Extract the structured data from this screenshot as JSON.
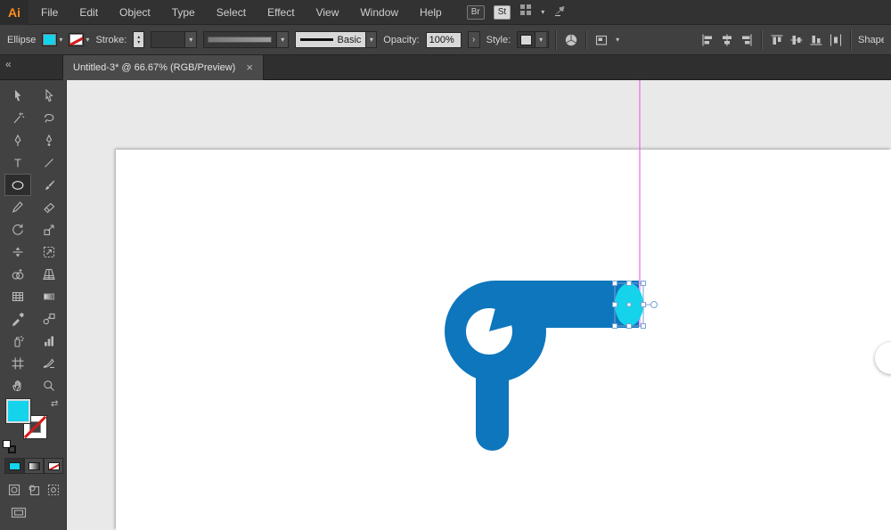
{
  "app": {
    "logo": "Ai"
  },
  "menu": {
    "items": [
      "File",
      "Edit",
      "Object",
      "Type",
      "Select",
      "Effect",
      "View",
      "Window",
      "Help"
    ]
  },
  "menu_right": {
    "bridge": "Br",
    "stock": "St"
  },
  "control": {
    "tool_name": "Ellipse",
    "stroke_label": "Stroke:",
    "brush_name": "Basic",
    "opacity_label": "Opacity:",
    "opacity_value": "100%",
    "style_label": "Style:",
    "shape_label": "Shape"
  },
  "tab": {
    "title": "Untitled-3* @ 66.67% (RGB/Preview)"
  },
  "toolbar": {
    "active_tool": "ellipse",
    "tools": [
      "selection",
      "direct-selection",
      "magic-wand",
      "lasso",
      "pen",
      "curvature",
      "type",
      "line-segment",
      "ellipse",
      "paintbrush",
      "pencil",
      "eraser",
      "rotate",
      "scale",
      "width",
      "free-transform",
      "shape-builder",
      "perspective-grid",
      "mesh",
      "gradient",
      "eyedropper",
      "blend",
      "symbol-sprayer",
      "column-graph",
      "artboard",
      "slice",
      "hand",
      "zoom"
    ]
  },
  "icons": {
    "chevron_down": "▾",
    "chevron_right": "›",
    "collapse_left": "«",
    "close": "×",
    "swap": "⇄",
    "spin_up": "▴",
    "spin_down": "▾",
    "type_glyph": "T"
  },
  "colors": {
    "fill_cyan": "#15d3ea",
    "shape_blue": "#0e76bc",
    "guide_magenta": "#ee4bee",
    "selection_blue": "#7aa3d4",
    "artboard_white": "#ffffff",
    "canvas_gray": "#e9e9e9"
  }
}
